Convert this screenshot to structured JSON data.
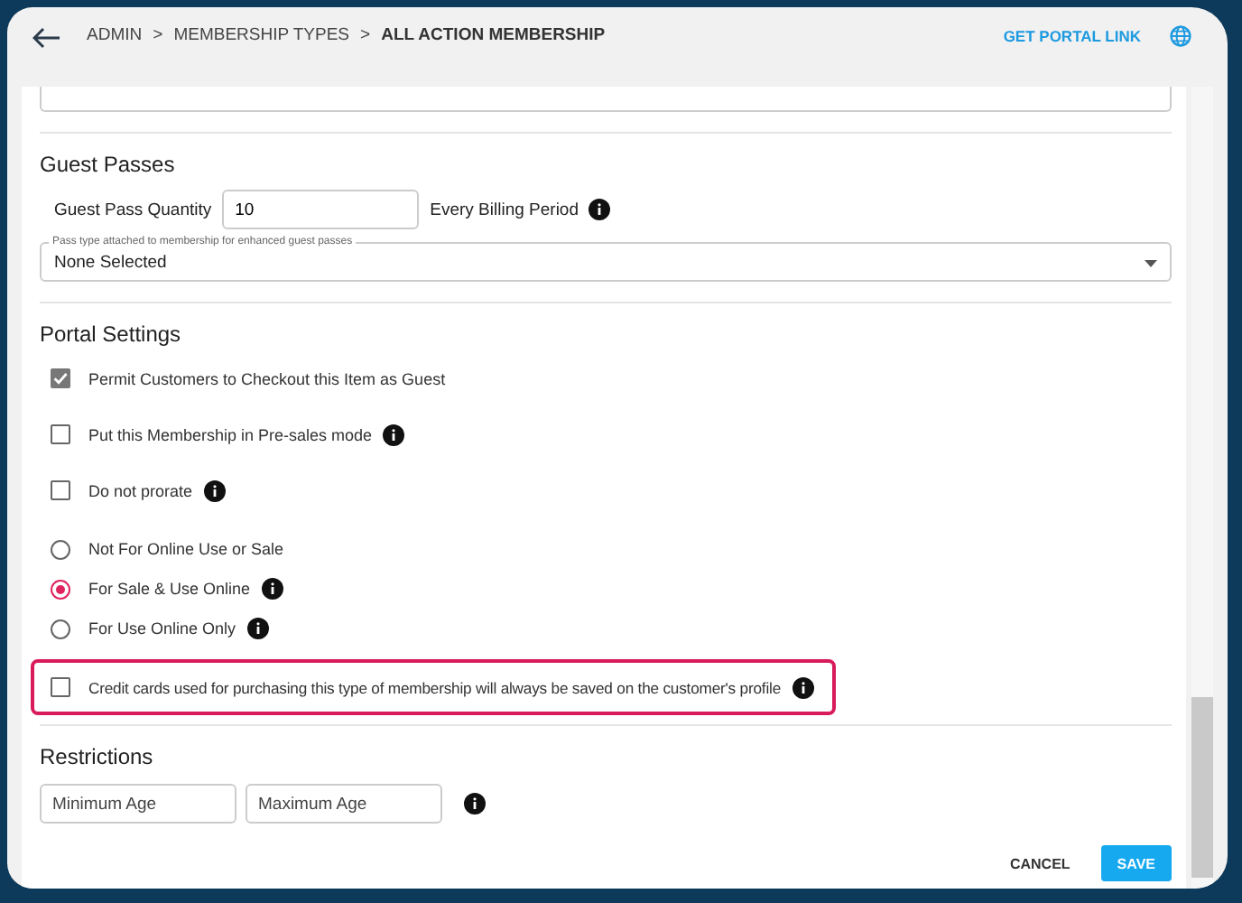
{
  "breadcrumb": [
    {
      "label": "ADMIN",
      "current": false
    },
    {
      "label": "MEMBERSHIP TYPES",
      "current": false,
      "separator": ">"
    },
    {
      "label": "ALL ACTION MEMBERSHIP",
      "current": true,
      "separator": ">"
    }
  ],
  "portal_link": "GET PORTAL LINK",
  "guest_passes": {
    "title": "Guest Passes",
    "quantity_label": "Guest Pass Quantity",
    "quantity": "10",
    "period_label": "Every Billing Period",
    "pass_type_label": "Pass type attached to membership for enhanced guest passes",
    "pass_type": "None Selected"
  },
  "portal_settings": {
    "title": "Portal Settings",
    "options": [
      {
        "kind": "checkbox",
        "label": "Permit Customers to Checkout this Item as Guest",
        "checked": true,
        "info": false,
        "highlighted": false
      },
      {
        "kind": "checkbox",
        "label": "Put this Membership in Pre-sales mode",
        "checked": false,
        "info": true,
        "highlighted": false
      },
      {
        "kind": "checkbox",
        "label": "Do not prorate",
        "checked": false,
        "info": true,
        "highlighted": false
      },
      {
        "kind": "radio",
        "label": "Not For Online Use or Sale",
        "selected": false,
        "info": false,
        "highlighted": false
      },
      {
        "kind": "radio",
        "label": "For Sale & Use Online",
        "selected": true,
        "info": true,
        "highlighted": false
      },
      {
        "kind": "radio",
        "label": "For Use Online Only",
        "selected": false,
        "info": true,
        "highlighted": false
      },
      {
        "kind": "checkbox",
        "label": "Credit cards used for purchasing this type of membership will always be saved on the customer's profile",
        "checked": false,
        "info": true,
        "highlighted": true
      }
    ]
  },
  "restrictions": {
    "title": "Restrictions",
    "fields": [
      {
        "placeholder": "Minimum Age"
      },
      {
        "placeholder": "Maximum Age"
      }
    ]
  },
  "buttons": [
    {
      "label": "CANCEL",
      "kind": "text"
    },
    {
      "label": "SAVE",
      "kind": "primary"
    }
  ]
}
